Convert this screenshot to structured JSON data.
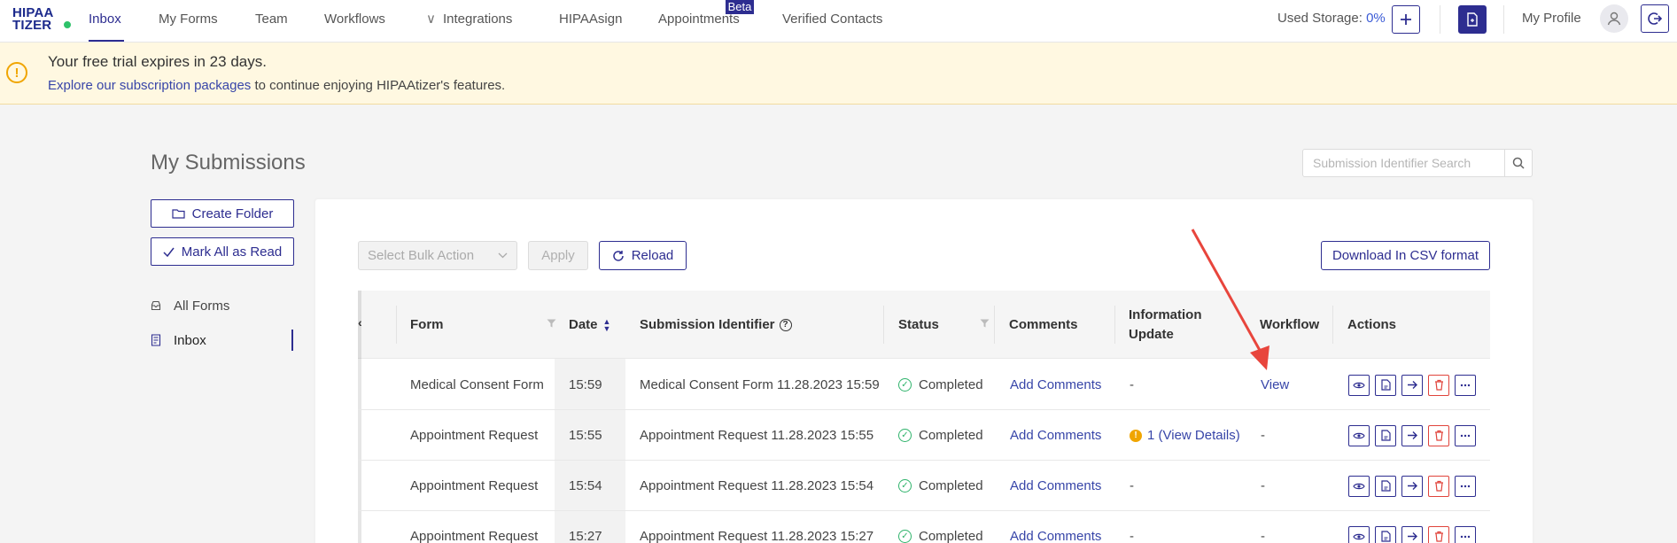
{
  "nav": {
    "logo_line1": "HIPAA",
    "logo_line2": "TIZER",
    "items": [
      "Inbox",
      "My Forms",
      "Team",
      "Workflows",
      "Integrations",
      "HIPAAsign",
      "Appointments",
      "Verified Contacts"
    ],
    "beta_badge": "Beta",
    "storage_label": "Used Storage:",
    "storage_value": "0%",
    "profile_label": "My Profile"
  },
  "banner": {
    "line1": "Your free trial expires in 23 days.",
    "link": "Explore our subscription packages",
    "line2_rest": " to continue enjoying HIPAAtizer's features."
  },
  "page": {
    "title": "My Submissions",
    "search_placeholder": "Submission Identifier Search"
  },
  "sidebar": {
    "create_folder": "Create Folder",
    "mark_all_read": "Mark All as Read",
    "items": [
      "All Forms",
      "Inbox"
    ]
  },
  "toolbar": {
    "bulk_placeholder": "Select Bulk Action",
    "apply": "Apply",
    "reload": "Reload",
    "csv": "Download In CSV format"
  },
  "table": {
    "headers": {
      "form": "Form",
      "date": "Date",
      "identifier": "Submission Identifier",
      "status": "Status",
      "comments": "Comments",
      "info_line1": "Information",
      "info_line2": "Update",
      "workflow": "Workflow",
      "actions": "Actions"
    },
    "rows": [
      {
        "form": "Medical Consent Form",
        "date": "15:59",
        "identifier": "Medical Consent Form 11.28.2023 15:59",
        "status": "Completed",
        "comments": "Add Comments",
        "info": "-",
        "workflow": "View"
      },
      {
        "form": "Appointment Request",
        "date": "15:55",
        "identifier": "Appointment Request 11.28.2023 15:55",
        "status": "Completed",
        "comments": "Add Comments",
        "info": "1 (View Details)",
        "workflow": "-"
      },
      {
        "form": "Appointment Request",
        "date": "15:54",
        "identifier": "Appointment Request 11.28.2023 15:54",
        "status": "Completed",
        "comments": "Add Comments",
        "info": "-",
        "workflow": "-"
      },
      {
        "form": "Appointment Request",
        "date": "15:27",
        "identifier": "Appointment Request 11.28.2023 15:27",
        "status": "Completed",
        "comments": "Add Comments",
        "info": "-",
        "workflow": "-"
      }
    ]
  },
  "colors": {
    "brand": "#2d2d90",
    "link": "#3745a8",
    "success": "#2fb36b",
    "warning": "#f0a500",
    "danger": "#e0443c",
    "annotation_arrow": "#e8453c"
  }
}
